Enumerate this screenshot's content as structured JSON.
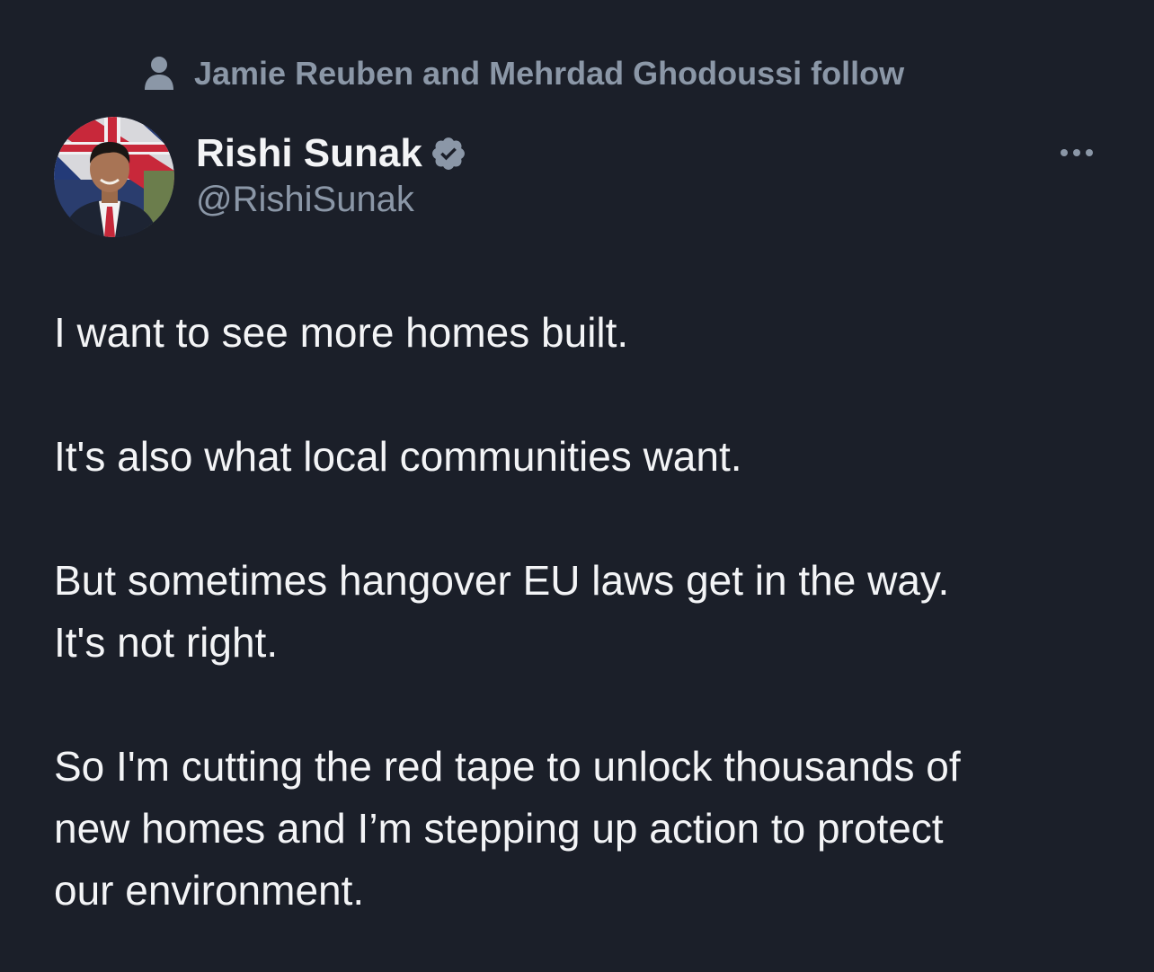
{
  "social_context": {
    "icon": "person-icon",
    "text": "Jamie Reuben and Mehrdad Ghodoussi follow"
  },
  "author": {
    "display_name": "Rishi Sunak",
    "handle": "@RishiSunak",
    "verified": true,
    "verified_icon": "verified-badge-icon",
    "avatar_icon": "profile-photo"
  },
  "more_icon": "more-options-icon",
  "tweet": {
    "paragraphs": [
      "I want to see more homes built.",
      "It's also what local communities want.",
      "But sometimes hangover EU laws get in the way.\nIt's not right.",
      "So I'm cutting the red tape to unlock thousands of\nnew homes and I’m stepping up action to protect\nour environment."
    ]
  },
  "colors": {
    "background": "#1b1f29",
    "primary_text": "#f3f4f6",
    "secondary_text": "#8b97a7"
  }
}
